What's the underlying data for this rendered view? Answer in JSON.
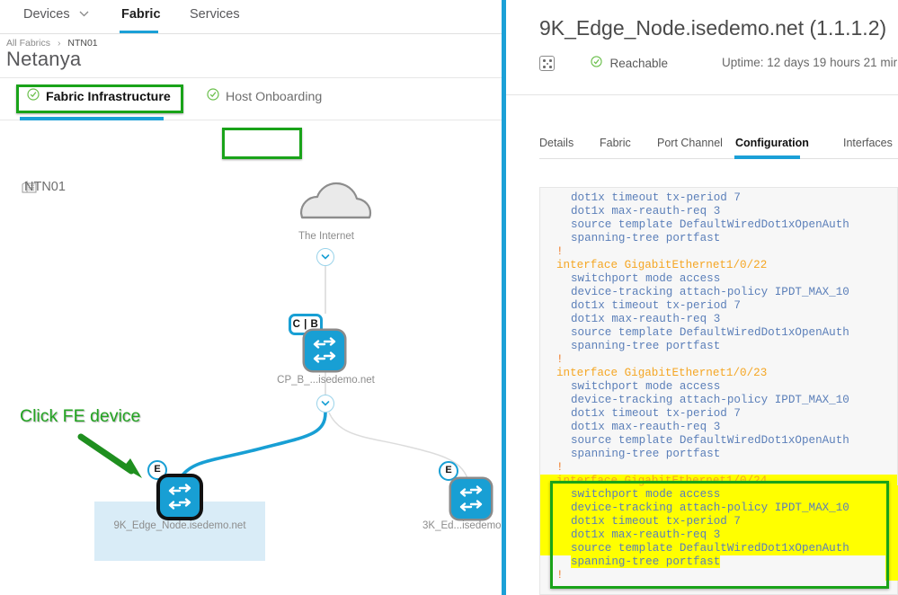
{
  "left_pane": {
    "topnav": {
      "items": [
        {
          "label": "Devices",
          "has_caret": true,
          "active": false
        },
        {
          "label": "Fabric",
          "has_caret": false,
          "active": true
        },
        {
          "label": "Services",
          "has_caret": false,
          "active": false
        }
      ]
    },
    "breadcrumb": {
      "root": "All Fabrics",
      "separator": "›",
      "current": "NTN01"
    },
    "page_title": "Netanya",
    "subtabs": [
      {
        "label": "Fabric Infrastructure",
        "check": "✔",
        "active": true,
        "highlighted": true
      },
      {
        "label": "Host Onboarding",
        "check": "✔",
        "active": false,
        "highlighted": false
      }
    ],
    "topology": {
      "site_label": "NTN01",
      "site_icon": "building-icon",
      "annotation": "Click FE device",
      "nodes": [
        {
          "id": "internet",
          "label": "The Internet",
          "type": "cloud-icon"
        },
        {
          "id": "cpb",
          "label": "CP_B_...isedemo.net",
          "type": "switch-icon",
          "badge": "C | B"
        },
        {
          "id": "9k",
          "label": "9K_Edge_Node.isedemo.net",
          "type": "switch-icon",
          "badge": "E",
          "selected": true
        },
        {
          "id": "3k",
          "label": "3K_Ed...isedemo",
          "type": "switch-icon",
          "badge": "E",
          "selected": false
        }
      ]
    }
  },
  "right_pane": {
    "device_title": "9K_Edge_Node.isedemo.net (1.1.1.2)",
    "grid_icon": "device-grid-icon",
    "status": {
      "check": "✔",
      "label": "Reachable",
      "color": "#6abf4b"
    },
    "uptime": "Uptime: 12 days 19 hours 21 mir",
    "tabs": [
      {
        "label": "Details",
        "active": false
      },
      {
        "label": "Fabric",
        "active": false
      },
      {
        "label": "Port Channel",
        "active": false
      },
      {
        "label": "Configuration",
        "active": true,
        "highlighted": true
      },
      {
        "label": "Interfaces",
        "active": false
      }
    ],
    "configuration_lines": [
      {
        "text": "dot1x timeout tx-period 7",
        "style": "ind",
        "highlight": false
      },
      {
        "text": "dot1x max-reauth-req 3",
        "style": "ind",
        "highlight": false
      },
      {
        "text": "source template DefaultWiredDot1xOpenAuth",
        "style": "ind",
        "highlight": false
      },
      {
        "text": "spanning-tree portfast",
        "style": "ind",
        "highlight": false
      },
      {
        "text": "!",
        "style": "bang",
        "highlight": false
      },
      {
        "text": "interface GigabitEthernet1/0/22",
        "style": "kw",
        "highlight": false
      },
      {
        "text": "switchport mode access",
        "style": "ind",
        "highlight": false
      },
      {
        "text": "device-tracking attach-policy IPDT_MAX_10",
        "style": "ind",
        "highlight": false
      },
      {
        "text": "dot1x timeout tx-period 7",
        "style": "ind",
        "highlight": false
      },
      {
        "text": "dot1x max-reauth-req 3",
        "style": "ind",
        "highlight": false
      },
      {
        "text": "source template DefaultWiredDot1xOpenAuth",
        "style": "ind",
        "highlight": false
      },
      {
        "text": "spanning-tree portfast",
        "style": "ind",
        "highlight": false
      },
      {
        "text": "!",
        "style": "bang",
        "highlight": false
      },
      {
        "text": "interface GigabitEthernet1/0/23",
        "style": "kw",
        "highlight": false
      },
      {
        "text": "switchport mode access",
        "style": "ind",
        "highlight": false
      },
      {
        "text": "device-tracking attach-policy IPDT_MAX_10",
        "style": "ind",
        "highlight": false
      },
      {
        "text": "dot1x timeout tx-period 7",
        "style": "ind",
        "highlight": false
      },
      {
        "text": "dot1x max-reauth-req 3",
        "style": "ind",
        "highlight": false
      },
      {
        "text": "source template DefaultWiredDot1xOpenAuth",
        "style": "ind",
        "highlight": false
      },
      {
        "text": "spanning-tree portfast",
        "style": "ind",
        "highlight": false
      },
      {
        "text": "!",
        "style": "bang",
        "highlight": false
      },
      {
        "text": "interface GigabitEthernet1/0/24",
        "style": "kw",
        "highlight": true
      },
      {
        "text": "switchport mode access",
        "style": "ind",
        "highlight": true
      },
      {
        "text": "device-tracking attach-policy IPDT_MAX_10",
        "style": "ind",
        "highlight": true
      },
      {
        "text": "dot1x timeout tx-period 7",
        "style": "ind",
        "highlight": true
      },
      {
        "text": "dot1x max-reauth-req 3",
        "style": "ind",
        "highlight": true
      },
      {
        "text": "source template DefaultWiredDot1xOpenAuth",
        "style": "ind",
        "highlight": true
      },
      {
        "text": "spanning-tree portfast",
        "style": "ind",
        "highlight": true,
        "partial": true
      },
      {
        "text": "!",
        "style": "bang",
        "highlight": false
      }
    ]
  },
  "colors": {
    "accent_blue": "#1ba0d7",
    "device_blue": "#189fd4",
    "annotation_green": "#19a319",
    "highlight_yellow": "#ffff00",
    "keyword_orange": "#f5a623",
    "config_text_blue": "#5b7fb9",
    "status_green": "#6abf4b"
  }
}
